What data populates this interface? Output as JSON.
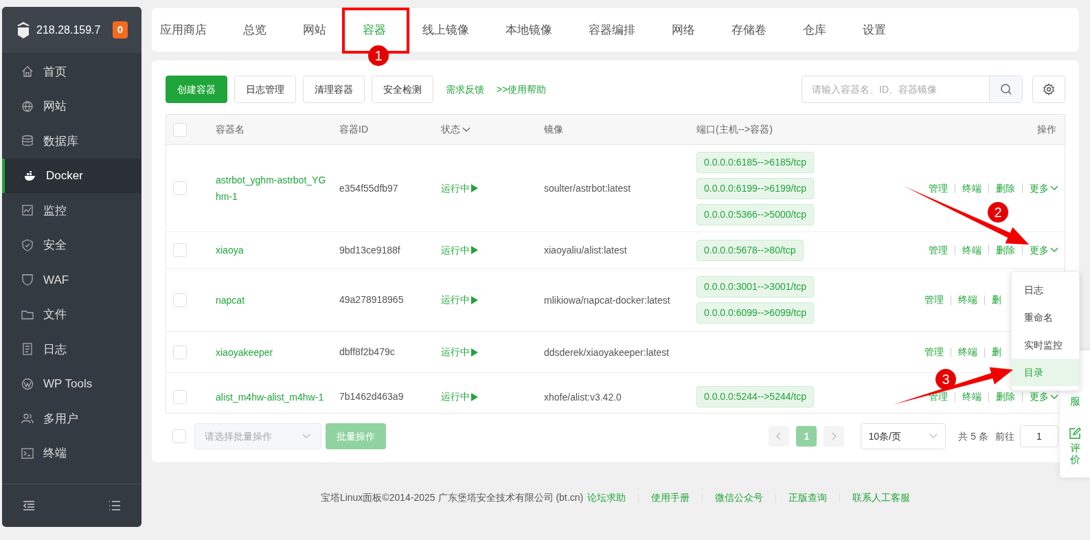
{
  "sidebar": {
    "host": "218.28.159.7",
    "badge": "0",
    "items": [
      {
        "label": "首页",
        "selected": false
      },
      {
        "label": "网站",
        "selected": false
      },
      {
        "label": "数据库",
        "selected": false
      },
      {
        "label": "Docker",
        "selected": true
      },
      {
        "label": "监控",
        "selected": false
      },
      {
        "label": "安全",
        "selected": false
      },
      {
        "label": "WAF",
        "selected": false
      },
      {
        "label": "文件",
        "selected": false
      },
      {
        "label": "日志",
        "selected": false
      },
      {
        "label": "WP Tools",
        "selected": false
      },
      {
        "label": "多用户",
        "selected": false
      },
      {
        "label": "终端",
        "selected": false
      }
    ]
  },
  "tabs": [
    {
      "label": "应用商店",
      "selected": false
    },
    {
      "label": "总览",
      "selected": false
    },
    {
      "label": "网站",
      "selected": false
    },
    {
      "label": "容器",
      "selected": true
    },
    {
      "label": "线上镜像",
      "selected": false
    },
    {
      "label": "本地镜像",
      "selected": false
    },
    {
      "label": "容器编排",
      "selected": false
    },
    {
      "label": "网络",
      "selected": false
    },
    {
      "label": "存储卷",
      "selected": false
    },
    {
      "label": "仓库",
      "selected": false
    },
    {
      "label": "设置",
      "selected": false
    }
  ],
  "toolbar": {
    "buttons": [
      {
        "label": "创建容器",
        "kind": "primary"
      },
      {
        "label": "日志管理",
        "kind": "default"
      },
      {
        "label": "清理容器",
        "kind": "default"
      },
      {
        "label": "安全检测",
        "kind": "default"
      }
    ],
    "links": [
      "需求反馈",
      ">>使用帮助"
    ],
    "search": {
      "placeholder": "请输入容器名、ID、容器镜像"
    }
  },
  "table": {
    "all_checked": false,
    "columns": [
      "容器名",
      "容器ID",
      "状态",
      "镜像",
      "端口(主机-->容器)",
      "操作"
    ],
    "rows": [
      {
        "checked": false,
        "name": "astrbot_yghm-astrbot_YGhm-1",
        "id": "e354f55dfb97",
        "status": "运行中",
        "image": "soulter/astrbot:latest",
        "ports": [
          "0.0.0.0:6185-->6185/tcp",
          "0.0.0.0:6199-->6199/tcp",
          "0.0.0.0:5366-->5000/tcp"
        ],
        "actions": [
          "管理",
          "终端",
          "删除",
          "更多"
        ]
      },
      {
        "checked": false,
        "name": "xiaoya",
        "id": "9bd13ce9188f",
        "status": "运行中",
        "image": "xiaoyaliu/alist:latest",
        "ports": [
          "0.0.0.0:5678-->80/tcp"
        ],
        "actions": [
          "管理",
          "终端",
          "删除",
          "更多"
        ]
      },
      {
        "checked": false,
        "name": "napcat",
        "id": "49a278918965",
        "status": "运行中",
        "image": "mlikiowa/napcat-docker:latest",
        "ports": [
          "0.0.0.0:3001-->3001/tcp",
          "0.0.0.0:6099-->6099/tcp"
        ],
        "actions": [
          "管理",
          "终端",
          "删"
        ]
      },
      {
        "checked": false,
        "name": "xiaoyakeeper",
        "id": "dbff8f2b479c",
        "status": "运行中",
        "image": "ddsderek/xiaoyakeeper:latest",
        "ports": [],
        "actions": [
          "管理",
          "终端",
          "删"
        ]
      },
      {
        "checked": false,
        "name": "alist_m4hw-alist_m4hw-1",
        "id": "7b1462d463a9",
        "status": "运行中",
        "image": "xhofe/alist:v3.42.0",
        "ports": [
          "0.0.0.0:5244-->5244/tcp"
        ],
        "actions": [
          "管理",
          "终端",
          "删除",
          "更多"
        ]
      }
    ]
  },
  "dropdown": {
    "items": [
      {
        "label": "日志",
        "selected": false
      },
      {
        "label": "重命名",
        "selected": false
      },
      {
        "label": "实时监控",
        "selected": false
      },
      {
        "label": "目录",
        "selected": true
      }
    ]
  },
  "bulk": {
    "checked": false,
    "placeholder": "请选择批量操作",
    "button": "批量操作"
  },
  "pagination": {
    "page": "1",
    "page_size": "10条/页",
    "total": "共 5 条",
    "goto": "前往",
    "goto_value": "1"
  },
  "side_float": {
    "items": [
      "服",
      "评价"
    ]
  },
  "footer": {
    "copyright": "宝塔Linux面板©2014-2025 广东堡塔安全技术有限公司 (bt.cn)",
    "links": [
      "论坛求助",
      "使用手册",
      "微信公众号",
      "正版查询",
      "联系人工客服"
    ]
  },
  "annotations": [
    {
      "label": "1"
    },
    {
      "label": "2"
    },
    {
      "label": "3"
    }
  ]
}
